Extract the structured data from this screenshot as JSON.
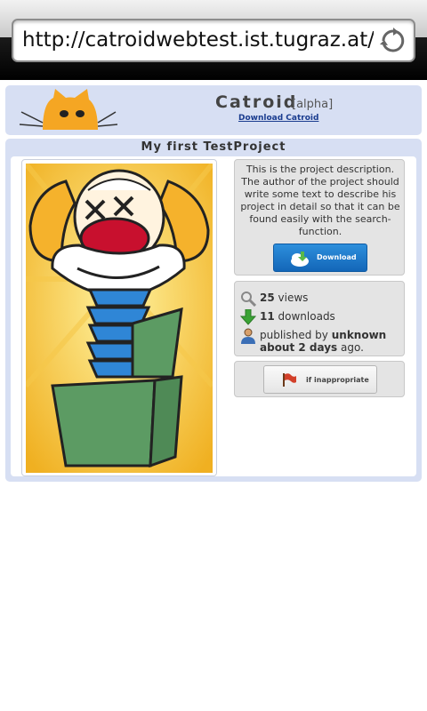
{
  "browser": {
    "url": "http://catroidwebtest.ist.tugraz.at/..."
  },
  "header": {
    "brand": "Catroid",
    "alpha": "[alpha]",
    "download_link": "Download Catroid"
  },
  "project": {
    "title": "My first TestProject",
    "description": "This is the project description. The author of the project should write some text to describe his project in detail so that it can be found easily with the search-function.",
    "download_button": "Download",
    "views_count": "25",
    "views_label": "views",
    "downloads_count": "11",
    "downloads_label": "downloads",
    "published_prefix": "published by",
    "author": "unknown",
    "published_when": "about 2 days",
    "published_suffix": "ago.",
    "report_button": "if inappropriate"
  },
  "colors": {
    "panel_bg": "#d7dff3",
    "download_button": "#1c74c8",
    "logo_orange": "#f5a623"
  },
  "icons": {
    "reload": "reload-icon",
    "views": "magnifier-icon",
    "downloads": "down-arrow-icon",
    "author": "user-icon",
    "report": "flag-icon"
  }
}
